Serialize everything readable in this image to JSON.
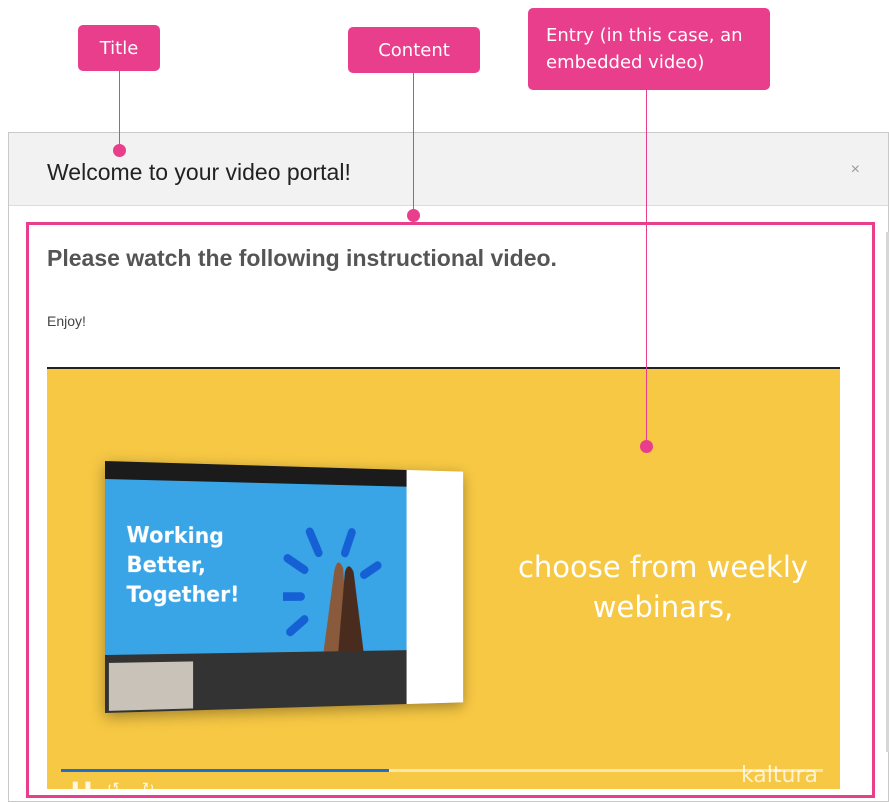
{
  "callouts": {
    "title": "Title",
    "content": "Content",
    "entry": "Entry (in this case, an embedded video)"
  },
  "modal": {
    "title": "Welcome to your video portal!",
    "close": "×"
  },
  "content": {
    "heading": "Please watch the following instructional video.",
    "body": "Enjoy!"
  },
  "video": {
    "slide_text": "Working Better, Together!",
    "tagline": "choose from weekly webinars,",
    "brand": "kaltura",
    "progress_fraction": 0.43
  },
  "colors": {
    "accent": "#e83e8c",
    "video_bg": "#f7c843",
    "progress": "#1f6fd1"
  }
}
